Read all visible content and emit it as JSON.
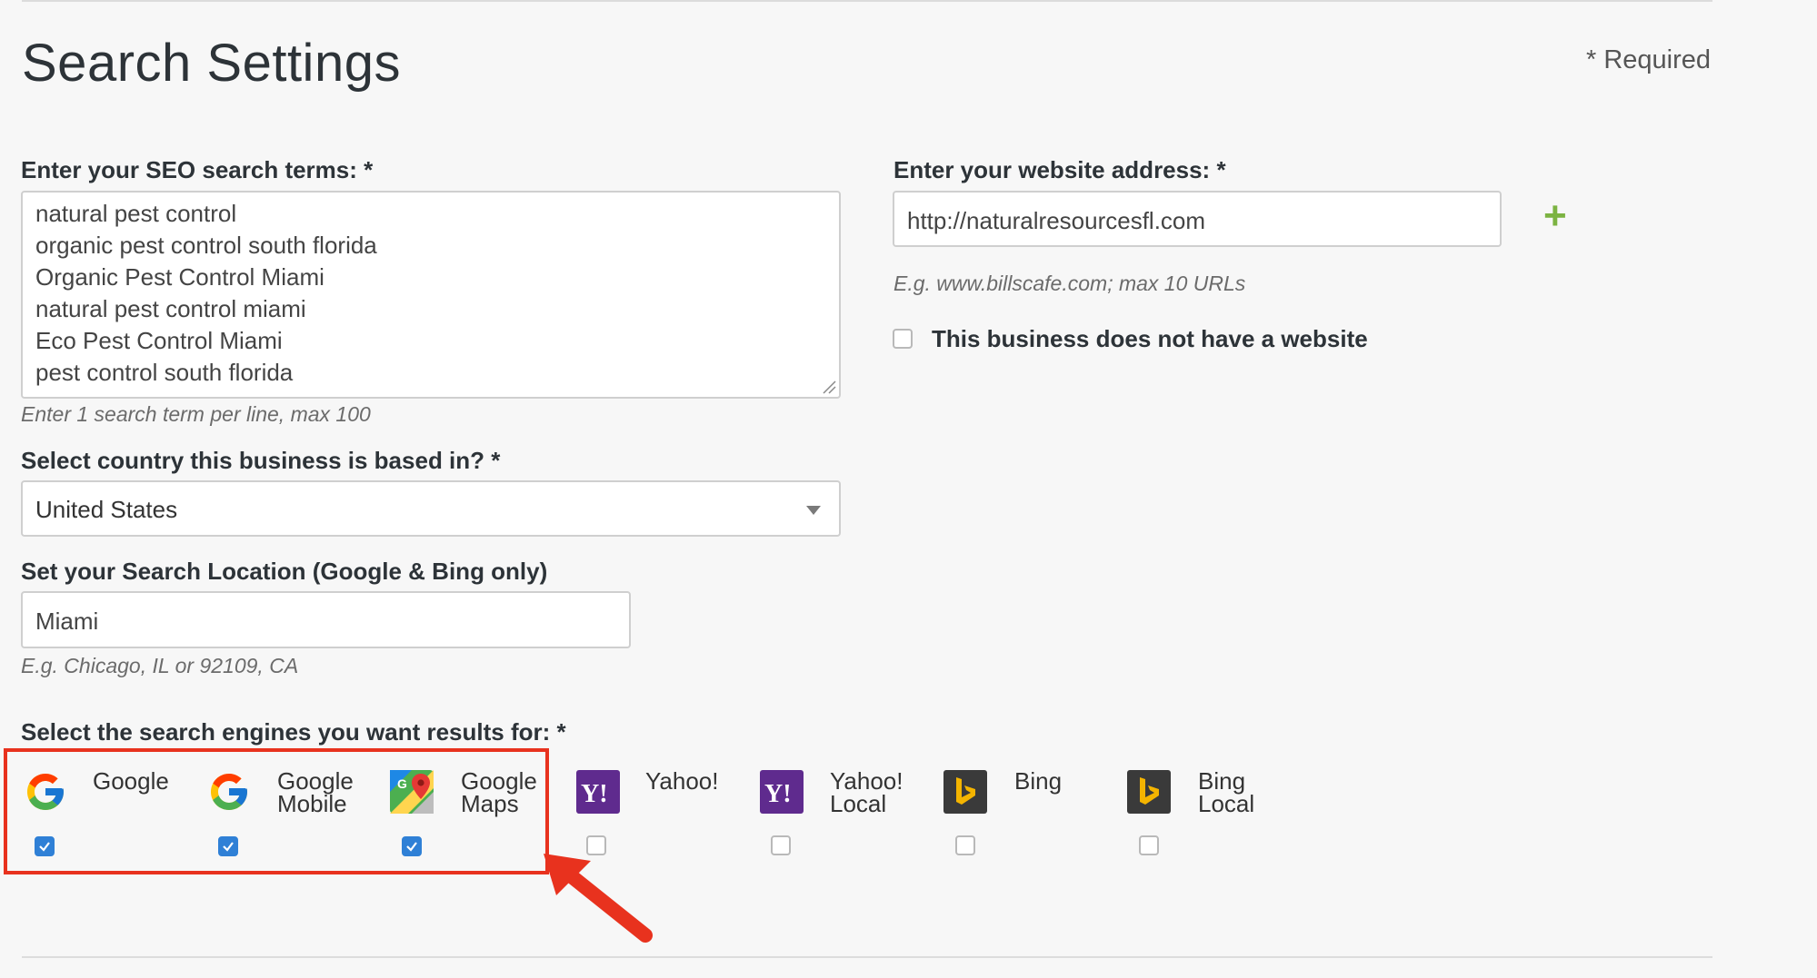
{
  "header": {
    "title": "Search Settings",
    "required_note": "*  Required"
  },
  "terms": {
    "label": "Enter your SEO search terms: *",
    "lines": [
      "natural pest control",
      "organic pest control south florida",
      "Organic Pest Control Miami",
      "natural pest control miami",
      "Eco Pest Control Miami",
      "pest control south florida"
    ],
    "hint": "Enter 1 search term per line, max 100"
  },
  "country": {
    "label": "Select country this business is based in? *",
    "value": "United States"
  },
  "location": {
    "label": "Set your Search Location (Google & Bing only)",
    "value": "Miami",
    "hint": "E.g. Chicago, IL or 92109, CA"
  },
  "website": {
    "label": "Enter your website address: *",
    "value": "http://naturalresourcesfl.com",
    "hint": "E.g. www.billscafe.com; max 10 URLs",
    "add_icon": "plus-icon",
    "no_website_label": "This business does not have a website",
    "no_website_checked": false
  },
  "engines": {
    "label": "Select the search engines you want results for: *",
    "items": [
      {
        "name_line1": "Google",
        "name_line2": "",
        "icon": "google-icon",
        "checked": true
      },
      {
        "name_line1": "Google",
        "name_line2": "Mobile",
        "icon": "google-icon",
        "checked": true
      },
      {
        "name_line1": "Google",
        "name_line2": "Maps",
        "icon": "google-maps-icon",
        "checked": true
      },
      {
        "name_line1": "Yahoo!",
        "name_line2": "",
        "icon": "yahoo-icon",
        "checked": false
      },
      {
        "name_line1": "Yahoo!",
        "name_line2": "Local",
        "icon": "yahoo-icon",
        "checked": false
      },
      {
        "name_line1": "Bing",
        "name_line2": "",
        "icon": "bing-icon",
        "checked": false
      },
      {
        "name_line1": "Bing",
        "name_line2": "Local",
        "icon": "bing-icon",
        "checked": false
      }
    ]
  },
  "colors": {
    "accent_check": "#2f80d6",
    "plus": "#7cb342",
    "annotation": "#e8321e",
    "yahoo": "#5f2b8e",
    "bing_bg": "#3a3a3a",
    "bing_logo": "#f4b400"
  }
}
